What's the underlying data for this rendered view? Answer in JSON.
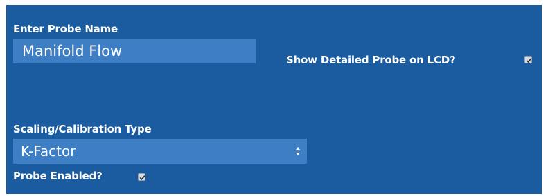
{
  "probe_name": {
    "label": "Enter Probe Name",
    "value": "Manifold Flow"
  },
  "show_detailed": {
    "label": "Show Detailed Probe on LCD?",
    "checked": true
  },
  "scaling": {
    "label": "Scaling/Calibration Type",
    "selected": "K-Factor"
  },
  "probe_enabled": {
    "label": "Probe Enabled?",
    "checked": true
  },
  "colors": {
    "panel_bg": "#1a5c9f",
    "field_bg": "#3d7ec4",
    "text": "#ffffff"
  }
}
